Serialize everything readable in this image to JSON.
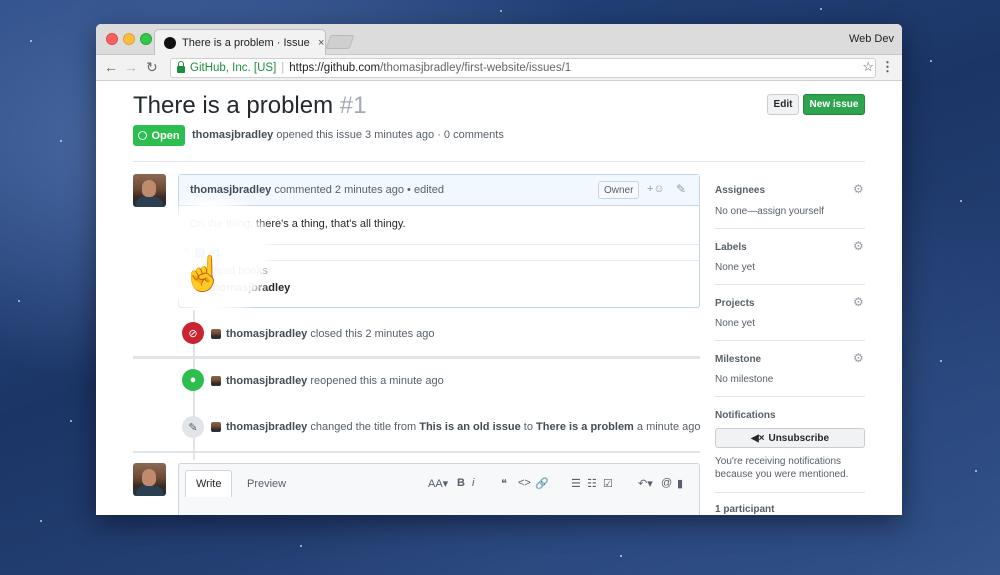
{
  "browser": {
    "tab_title": "There is a problem · Issue #1 · ",
    "tab_close": "×",
    "profile": "Web Dev",
    "secure_label": "GitHub, Inc. [US]",
    "url_scheme_host": "https://github.com",
    "url_path": "/thomasjbradley/first-website/issues/1"
  },
  "issue": {
    "title": "There is a problem",
    "number": "#1",
    "state": "Open",
    "author": "thomasjbradley",
    "meta_text": "opened this issue 3 minutes ago · 0 comments",
    "edit_label": "Edit",
    "new_issue_label": "New issue"
  },
  "comment": {
    "author": "thomasjbradley",
    "meta": "commented 2 minutes ago • edited",
    "owner_label": "Owner",
    "body": "On the thing, there's a thing, that's all thingy.",
    "task_link": "#1",
    "task_line": "Read books",
    "task_author": "thomasjbradley"
  },
  "timeline": [
    {
      "user": "thomasjbradley",
      "text": "closed this 2 minutes ago",
      "badge_color": "#cb2431"
    },
    {
      "user": "thomasjbradley",
      "text": "reopened this a minute ago",
      "badge_color": "#2cbe4e"
    },
    {
      "user": "thomasjbradley",
      "text_before": "changed the title from",
      "old_title": "This is an old issue",
      "to": "to",
      "new_title": "There is a problem",
      "text_after": "a minute ago",
      "badge_color": "#e1e4e8"
    }
  ],
  "editor": {
    "write_tab": "Write",
    "preview_tab": "Preview",
    "tools": [
      "AA▾",
      "B",
      "i",
      "❝",
      "<>",
      "🔗",
      "☰",
      "☷",
      "☑",
      "↶▾",
      "@",
      "▮"
    ]
  },
  "sidebar": {
    "assignees_label": "Assignees",
    "assignees_value": "No one—assign yourself",
    "labels_label": "Labels",
    "labels_value": "None yet",
    "projects_label": "Projects",
    "projects_value": "None yet",
    "milestone_label": "Milestone",
    "milestone_value": "No milestone",
    "notifications_label": "Notifications",
    "unsubscribe_label": "Unsubscribe",
    "notifications_note": "You're receiving notifications because you were mentioned.",
    "participants_label": "1 participant"
  },
  "colors": {
    "open_green": "#2cbe4e",
    "new_issue_green": "#2ea44f",
    "closed_red": "#cb2431",
    "link_blue": "#0366d6"
  }
}
